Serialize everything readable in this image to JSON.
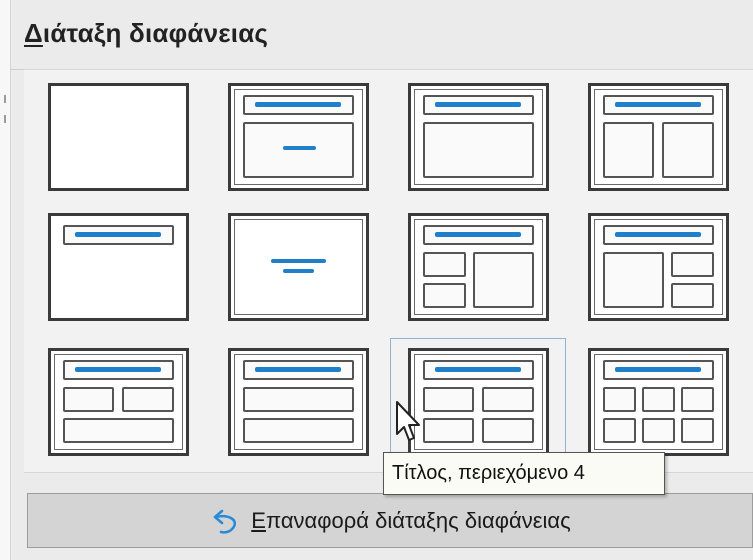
{
  "panel": {
    "title_accel": "Δ",
    "title_rest": "ιάταξη διαφάνειας"
  },
  "layouts": [
    {
      "id": "blank"
    },
    {
      "id": "title-slide"
    },
    {
      "id": "title-content"
    },
    {
      "id": "title-2-content"
    },
    {
      "id": "title-only"
    },
    {
      "id": "centered-text"
    },
    {
      "id": "title-2-content-and-content"
    },
    {
      "id": "title-content-and-2-content"
    },
    {
      "id": "title-2-content-over-content"
    },
    {
      "id": "title-content-over-content"
    },
    {
      "id": "title-4-content",
      "selected": true
    },
    {
      "id": "title-6-content"
    }
  ],
  "tooltip": {
    "text": "Τίτλος, περιεχόμενο 4"
  },
  "reset_button": {
    "accel": "Ε",
    "label_rest": "παναφορά διάταξης διαφάνειας",
    "icon": "undo-arrow-icon"
  },
  "colors": {
    "accent": "#1f7fc8",
    "selection_border": "#8fb3d1",
    "tooltip_bg": "#fbfbf5"
  }
}
